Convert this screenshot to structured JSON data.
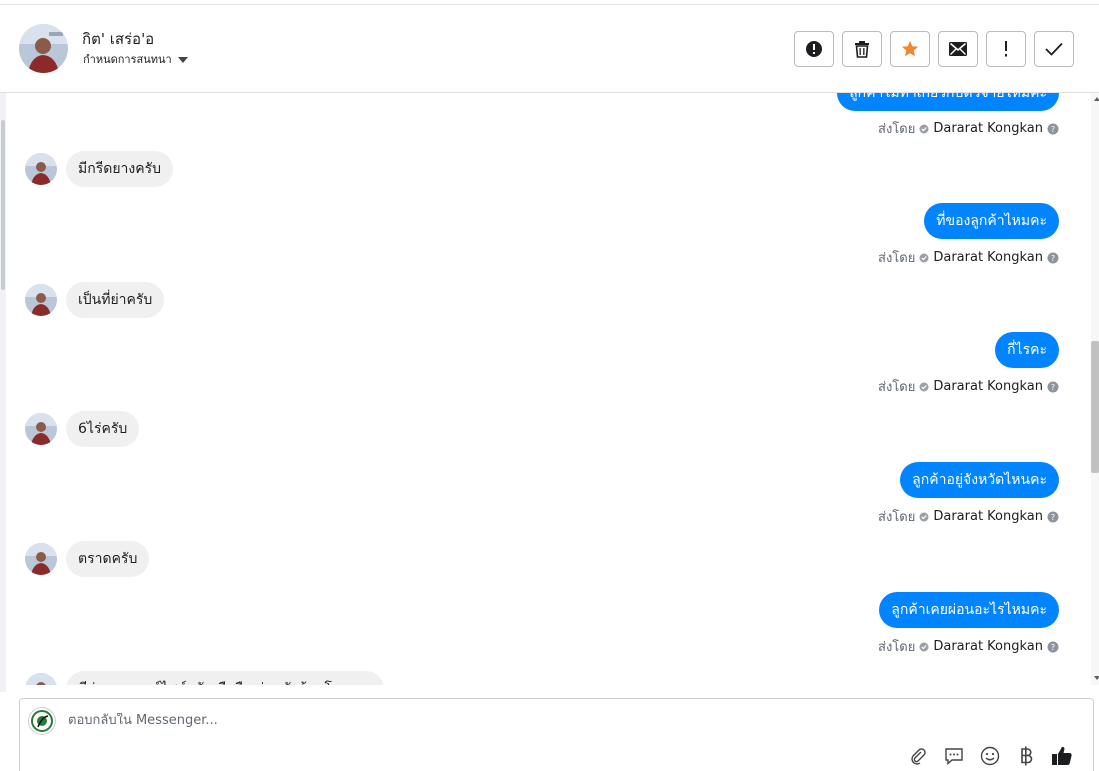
{
  "header": {
    "contact_name": "กิต' เสร่อ'อ",
    "assign_label": "กำหนดการสนทนา"
  },
  "messages": [
    {
      "type": "out-partial",
      "text": "ลูกค้าไม่ทำเกี่ยวกับตัวจ่ายไหมคะ"
    },
    {
      "type": "sent-by",
      "prefix": "ส่งโดย",
      "name": "Dararat Kongkan"
    },
    {
      "type": "in",
      "text": "มีกรีดยางครับ"
    },
    {
      "type": "out",
      "text": "ที่ของลูกค้าไหมคะ"
    },
    {
      "type": "sent-by",
      "prefix": "ส่งโดย",
      "name": "Dararat Kongkan"
    },
    {
      "type": "in",
      "text": "เป็นที่ย่าครับ"
    },
    {
      "type": "out",
      "text": "กี่ไรคะ"
    },
    {
      "type": "sent-by",
      "prefix": "ส่งโดย",
      "name": "Dararat Kongkan"
    },
    {
      "type": "in",
      "text": "6ไร่ครับ"
    },
    {
      "type": "out",
      "text": "ลูกค้าอยู่จังหวัดไหนคะ"
    },
    {
      "type": "sent-by",
      "prefix": "ส่งโดย",
      "name": "Dararat Kongkan"
    },
    {
      "type": "in",
      "text": "ตราดครับ"
    },
    {
      "type": "out",
      "text": "ลูกค้าเคยผ่อนอะไรไหมคะ"
    },
    {
      "type": "sent-by",
      "prefix": "ส่งโดย",
      "name": "Dararat Kongkan"
    },
    {
      "type": "in-partial",
      "text": "มีผ่อนมอเตอร์ไซค์ครับ มือถือ ผ่อนกับร้านโอเคแอ"
    }
  ],
  "composer": {
    "placeholder": "ตอบกลับใน Messenger...",
    "tools": [
      "paperclip-icon",
      "speech-bubble-icon",
      "smiley-icon",
      "baht-icon",
      "thumbs-up-icon"
    ]
  },
  "colors": {
    "outgoing_bubble": "#0084ff",
    "incoming_bubble": "#f0f0f0",
    "star": "#f0862e"
  }
}
